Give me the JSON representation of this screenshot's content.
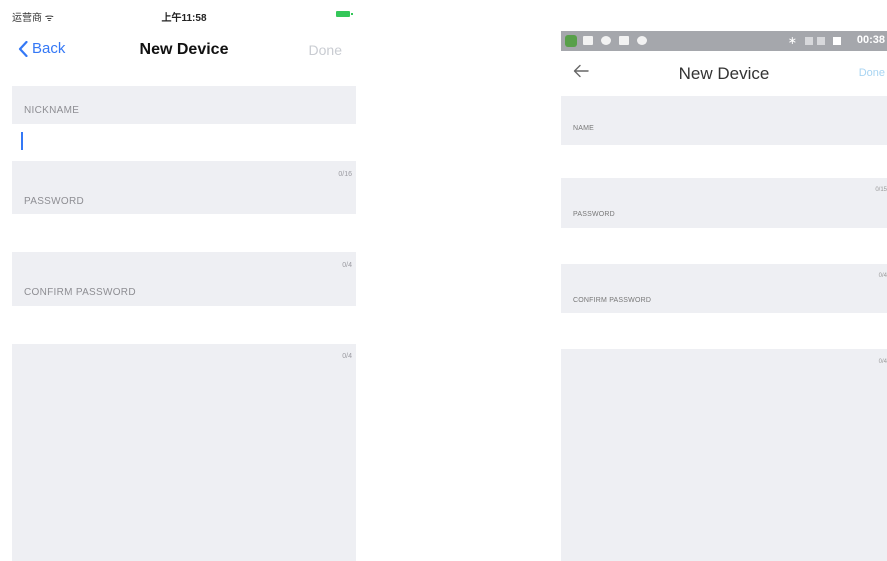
{
  "ios": {
    "status": {
      "carrier": "运营商 ᯤ",
      "time": "上午11:58"
    },
    "nav": {
      "back_label": "Back",
      "title": "New Device",
      "done_label": "Done"
    },
    "fields": {
      "nickname_label": "NICKNAME",
      "nickname_value": "",
      "nickname_count": "0/16",
      "password_label": "PASSWORD",
      "password_count": "0/4",
      "confirm_label": "CONFIRM PASSWORD",
      "confirm_count": "0/4"
    }
  },
  "android": {
    "status": {
      "time": "00:38",
      "bluetooth": "∗"
    },
    "nav": {
      "title": "New Device",
      "done_label": "Done"
    },
    "fields": {
      "name_label": "NAME",
      "name_count": "0/15",
      "password_label": "PASSWORD",
      "password_count": "0/4",
      "confirm_label": "CONFIRM PASSWORD",
      "confirm_count": "0/4"
    }
  },
  "colors": {
    "ios_tint": "#3478f6",
    "android_done": "#a8d4f2",
    "section_bg": "#eeeff3",
    "android_statusbar": "#a5a7ac"
  },
  "icons": [
    "chevron-left-icon",
    "wifi-icon",
    "battery-icon",
    "arrow-left-icon",
    "bluetooth-icon"
  ]
}
